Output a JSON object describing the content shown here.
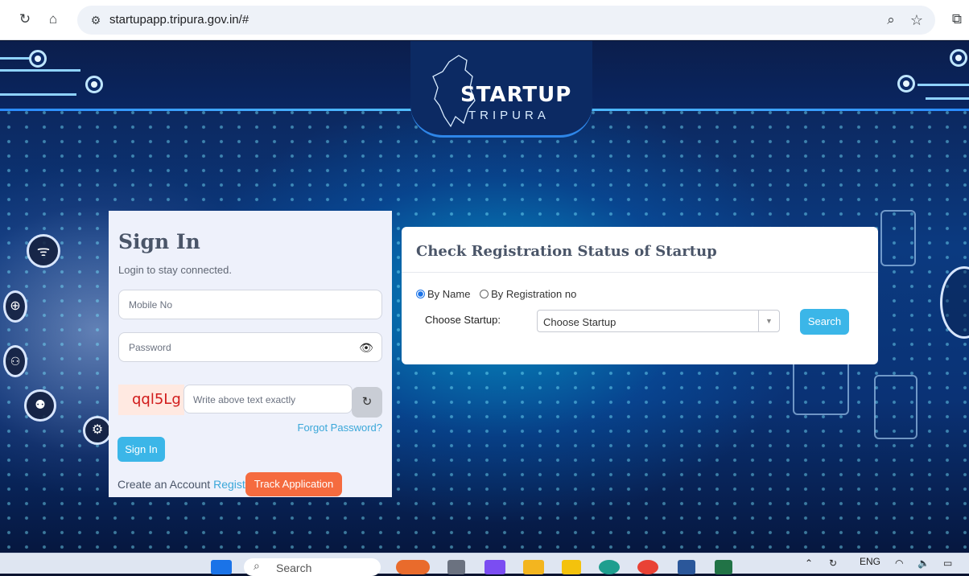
{
  "browser": {
    "url": "startupapp.tripura.gov.in/#"
  },
  "header": {
    "logo_title": "STARTUP",
    "logo_subtitle": "TRIPURA"
  },
  "signin": {
    "title": "Sign In",
    "subtitle": "Login to stay connected.",
    "mobile_placeholder": "Mobile No",
    "password_placeholder": "Password",
    "captcha_text": "qql5Lg",
    "captcha_placeholder": "Write above text exactly",
    "forgot_label": "Forgot Password?",
    "signin_label": "Sign In",
    "create_text": "Create an Account",
    "register_label": "Register",
    "track_label": "Track Application"
  },
  "status": {
    "title": "Check Registration Status of Startup",
    "radio_by_name": "By Name",
    "radio_by_reg": "By Registration no",
    "selected_option": "By Name",
    "choose_label": "Choose Startup:",
    "choose_value": "Choose Startup",
    "search_label": "Search"
  },
  "taskbar": {
    "search_label": "Search",
    "lang": "ENG"
  },
  "colors": {
    "accent_blue": "#3bb6e8",
    "track_orange": "#f56b3f",
    "captcha_red": "#d11b1b"
  }
}
